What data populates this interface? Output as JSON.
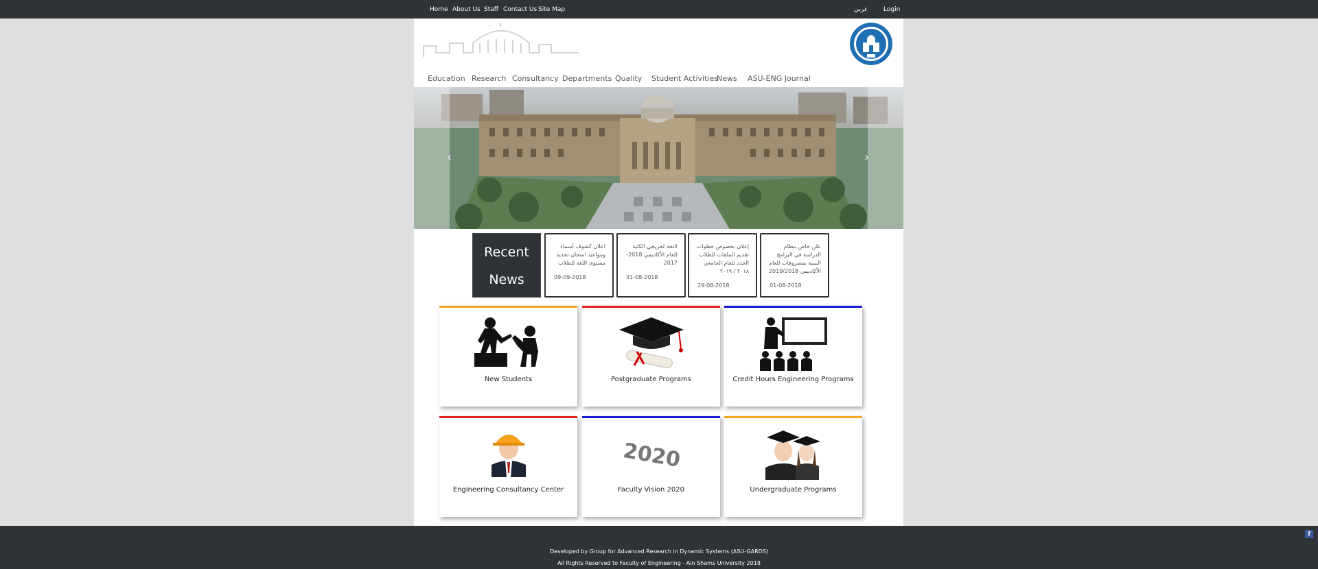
{
  "topbar": {
    "links": [
      "Home",
      "About Us",
      "Staff",
      "Contact Us",
      "Site Map"
    ],
    "lang": "عربي",
    "login": "Login"
  },
  "nav": [
    "Education",
    "Research",
    "Consultancy",
    "Departments",
    "Quality",
    "Student Activities",
    "News",
    "ASU-ENG Journal"
  ],
  "recent_news": {
    "title_line1": "Recent",
    "title_line2": "News",
    "items": [
      {
        "text": "اعلان كشوف أسماء ومواعيد امتحان تحديد مستوى اللغة للطلاب",
        "date": "09-09-2018"
      },
      {
        "text": "لائحة لخريجي الكلية للعام الأكاديمي 2018-2017",
        "date": "31-08-2018"
      },
      {
        "text": "إعلان بخصوص خطوات تقديم الملفات للطلاب الجدد للعام الجامعي ٢٠١٨ / ٢٠١٩",
        "date": "29-08-2018"
      },
      {
        "text": "علن خاص بنظام الدراسة في البرامج البينية بمصروفات للعام الأكاديمي 2019/2018",
        "date": "01-08-2018"
      }
    ]
  },
  "tiles": [
    {
      "label": "New Students",
      "color": "#f5a623"
    },
    {
      "label": "Postgraduate Programs",
      "color": "#e01f1f"
    },
    {
      "label": "Credit Hours Engineering Programs",
      "color": "#1a1ad6"
    },
    {
      "label": "Engineering Consultancy Center",
      "color": "#e01f1f"
    },
    {
      "label": "Faculty Vision 2020",
      "color": "#1a1ad6"
    },
    {
      "label": "Undergraduate Programs",
      "color": "#f5a623"
    }
  ],
  "vision_text": "2020",
  "footer": {
    "line1": "Developed by Group for Advanced Research in Dynamic Systems (ASU-GARDS)",
    "line2": "All Rights Reserved to Faculty of Engineering - Ain Shams University 2018"
  }
}
